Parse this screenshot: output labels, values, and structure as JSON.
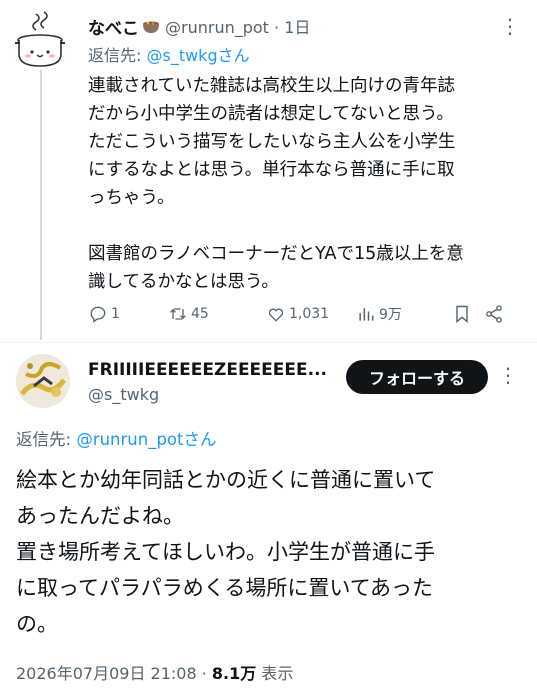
{
  "tweet1": {
    "display_name": "なべこ",
    "handle_time": "@runrun_pot · 1日",
    "reply_prefix": "返信先: ",
    "reply_handle": "@s_twkgさん",
    "body": "連載されていた雑誌は高校生以上向けの青年誌\nだから小中学生の読者は想定してないと思う。\nただこういう描写をしたいなら主人公を小学生\nにするなよとは思う。単行本なら普通に手に取\nっちゃう。\n\n図書館のラノベコーナーだとYAで15歳以上を意\n識してるかなとは思う。",
    "stats": {
      "replies": "1",
      "reposts": "45",
      "likes": "1,031",
      "views": "9万"
    }
  },
  "tweet2": {
    "display_name": "FRIIIIIEEEEEEZEEEEEEE...",
    "handle": "@s_twkg",
    "follow_label": "フォローする",
    "reply_prefix": "返信先: ",
    "reply_handle": "@runrun_potさん",
    "body": "絵本とか幼年同話とかの近くに普通に置いて\nあったんだよね。\n置き場所考えてほしいわ。小学生が普通に手\nに取ってパラパラめくる場所に置いてあった\nの。",
    "timestamp": "2026年07月09日 21:08 · ",
    "views_count": "8.1万",
    "views_label": " 表示"
  },
  "colors": {
    "link": "#1d9bf0",
    "muted": "#536471",
    "text": "#0f1419",
    "button_bg": "#0f1419"
  }
}
